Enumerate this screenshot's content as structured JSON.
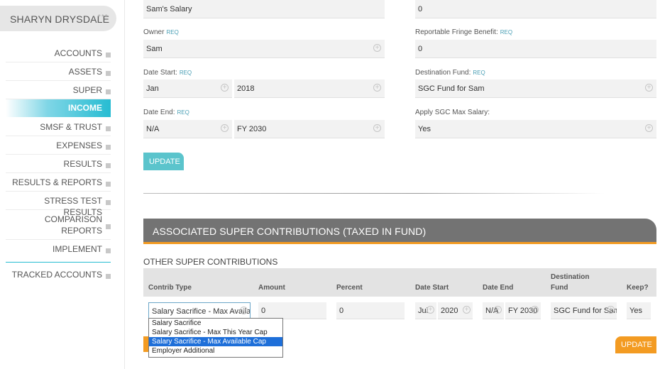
{
  "user": {
    "name": "SHARYN DRYSDALE",
    "stars": "***"
  },
  "sidebar": {
    "items": [
      {
        "label": "ACCOUNTS",
        "active": false
      },
      {
        "label": "ASSETS",
        "active": false
      },
      {
        "label": "SUPER",
        "active": false
      },
      {
        "label": "INCOME",
        "active": true
      },
      {
        "label": "SMSF & TRUST",
        "active": false
      },
      {
        "label": "EXPENSES",
        "active": false
      },
      {
        "label": "RESULTS",
        "active": false
      },
      {
        "label": "RESULTS & REPORTS",
        "active": false
      },
      {
        "label": "STRESS TEST RESULTS",
        "active": false
      },
      {
        "label": "COMPARISON REPORTS",
        "active": false
      },
      {
        "label": "IMPLEMENT",
        "active": false
      },
      {
        "label": "TRACKED ACCOUNTS",
        "active": false
      }
    ]
  },
  "form": {
    "req": "REQ",
    "name_value": "Sam's Salary",
    "top_right_value": "0",
    "owner": {
      "label": "Owner",
      "value": "Sam"
    },
    "fringe": {
      "label": "Reportable Fringe Benefit:",
      "value": "0"
    },
    "date_start": {
      "label": "Date Start:",
      "month": "Jan",
      "year": "2018"
    },
    "dest_fund": {
      "label": "Destination Fund:",
      "value": "SGC Fund for Sam"
    },
    "date_end": {
      "label": "Date End:",
      "month": "N/A",
      "year": "FY 2030"
    },
    "apply_sgc": {
      "label": "Apply SGC Max Salary:",
      "value": "Yes"
    },
    "update_label": "UPDATE"
  },
  "super_contrib": {
    "title": "ASSOCIATED SUPER CONTRIBUTIONS (TAXED IN FUND)",
    "subtitle": "OTHER SUPER CONTRIBUTIONS",
    "columns": {
      "contrib_type": "Contrib Type",
      "amount": "Amount",
      "percent": "Percent",
      "date_start": "Date Start",
      "date_end": "Date End",
      "dest_fund_1": "Destination",
      "dest_fund_2": "Fund",
      "keep": "Keep?"
    },
    "row": {
      "contrib_type": "Salary Sacrifice - Max Available Cap",
      "amount": "0",
      "percent": "0",
      "start_month": "Jul",
      "start_year": "2020",
      "end_month": "N/A",
      "end_year": "FY 2030",
      "dest_fund": "SGC Fund for Sam",
      "keep": "Yes"
    },
    "dropdown_options": [
      {
        "label": "Salary Sacrifice",
        "selected": false
      },
      {
        "label": "Salary Sacrifice - Max This Year Cap",
        "selected": false
      },
      {
        "label": "Salary Sacrifice - Max Available Cap",
        "selected": true
      },
      {
        "label": "Employer Additional",
        "selected": false
      }
    ],
    "update_label": "UPDATE"
  },
  "colors": {
    "accent_teal": "#27bcd2",
    "accent_orange": "#f39b22",
    "header_gray": "#737373",
    "select_blue": "#1e6fd9"
  }
}
